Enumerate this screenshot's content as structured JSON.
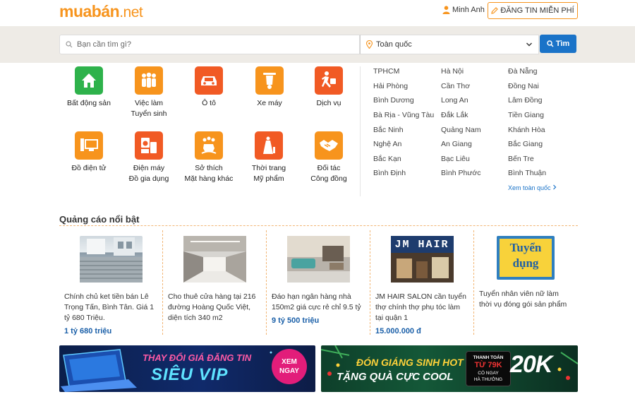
{
  "header": {
    "logo_part1": "muabán",
    "logo_part2": ".net",
    "user_name": "Minh Anh",
    "post_button": "ĐĂNG TIN MIỄN PHÍ"
  },
  "search": {
    "placeholder": "Bạn cần tìm gì?",
    "location": "Toàn quốc",
    "button": "Tìm"
  },
  "categories": [
    {
      "line1": "Bất động sản",
      "line2": "",
      "icon": "house-icon",
      "color": "#2eb24b"
    },
    {
      "line1": "Việc làm",
      "line2": "Tuyển sinh",
      "icon": "people-icon",
      "color": "#f7941d"
    },
    {
      "line1": "Ô tô",
      "line2": "",
      "icon": "car-icon",
      "color": "#f15a24"
    },
    {
      "line1": "Xe máy",
      "line2": "",
      "icon": "scooter-icon",
      "color": "#f7941d"
    },
    {
      "line1": "Dịch vụ",
      "line2": "",
      "icon": "runner-icon",
      "color": "#f15a24"
    },
    {
      "line1": "Đồ điện tử",
      "line2": "",
      "icon": "computer-icon",
      "color": "#f7941d"
    },
    {
      "line1": "Điện máy",
      "line2": "Đồ gia dụng",
      "icon": "appliance-icon",
      "color": "#f15a24"
    },
    {
      "line1": "Sở thích",
      "line2": "Mặt hàng khác",
      "icon": "toy-horse-icon",
      "color": "#f7941d"
    },
    {
      "line1": "Thời trang",
      "line2": "Mỹ phẩm",
      "icon": "fashion-icon",
      "color": "#f15a24"
    },
    {
      "line1": "Đối tác",
      "line2": "Công đồng",
      "icon": "handshake-icon",
      "color": "#f7941d"
    }
  ],
  "regions": [
    [
      "TPHCM",
      "Hà Nội",
      "Đà Nẵng"
    ],
    [
      "Hải Phòng",
      "Cần Thơ",
      "Đồng Nai"
    ],
    [
      "Bình Dương",
      "Long An",
      "Lâm Đồng"
    ],
    [
      "Bà Rịa - Vũng Tàu",
      "Đắk Lắk",
      "Tiền Giang"
    ],
    [
      "Bắc Ninh",
      "Quảng Nam",
      "Khánh Hòa"
    ],
    [
      "Nghệ An",
      "An Giang",
      "Bắc Giang"
    ],
    [
      "Bắc Kạn",
      "Bạc Liêu",
      "Bến Tre"
    ],
    [
      "Bình Định",
      "Bình Phước",
      "Bình Thuận"
    ]
  ],
  "all_regions_link": "Xem toàn quốc",
  "featured": {
    "title": "Quảng cáo nổi bật",
    "ads": [
      {
        "title": "Chính chủ ket tiền bán Lê Trọng Tấn, Bình Tân. Giá 1 tỷ 680 Triệu.",
        "price": "1 tỷ 680 triệu",
        "img_label": ""
      },
      {
        "title": "Cho thuê cửa hàng tại 216 đường Hoàng Quốc Việt, diện tích 340 m2",
        "price": "",
        "img_label": ""
      },
      {
        "title": "Đáo hạn ngân hàng nhà 150m2 giá cực rẻ chỉ 9.5 tỷ",
        "price": "9 tỷ 500 triệu",
        "img_label": ""
      },
      {
        "title": "JM HAIR SALON cần tuyển thợ chính thợ phụ tóc làm tại quận 1",
        "price": "15.000.000 đ",
        "img_label": "JM HAIR"
      },
      {
        "title": "Tuyển nhân viên nữ làm thời vụ đóng gói sản phẩm",
        "price": "",
        "img_label": "Tuyển dụng"
      }
    ]
  },
  "banners": [
    {
      "line1": "THAY ĐỔI GIÁ ĐĂNG TIN",
      "line2": "SIÊU VIP",
      "badge_line1": "XEM",
      "badge_line2": "NGAY"
    },
    {
      "line1": "ĐÓN GIÁNG SINH HOT",
      "line2": "TẶNG QUÀ CỰC COOL",
      "badge_line1": "THANH TOÁN",
      "badge_line2": "TỪ 79K",
      "badge_line3": "CÓ NGAY",
      "badge_line4": "HÀ THƯỞNG",
      "big": "20K"
    }
  ]
}
